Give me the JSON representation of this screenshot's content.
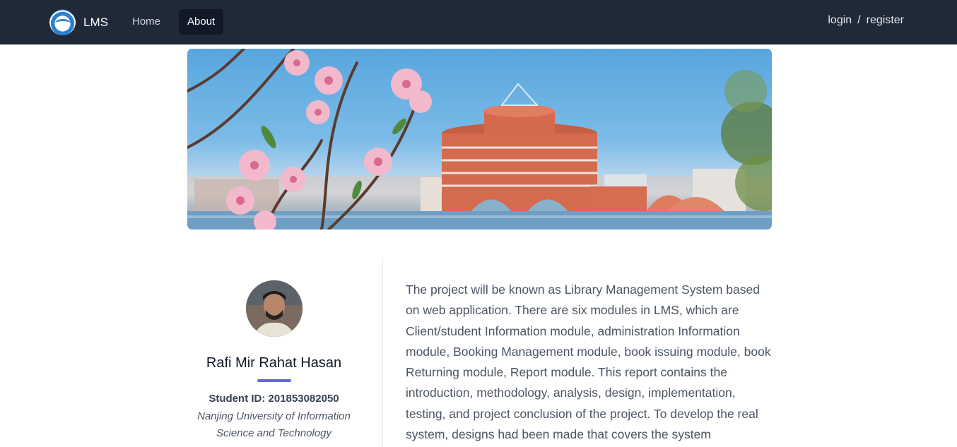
{
  "nav": {
    "brand": "LMS",
    "links": [
      "Home",
      "About"
    ],
    "active": "About",
    "login": "login",
    "separator": "/",
    "register": "register"
  },
  "hero": {
    "alt": "Campus building with blossoms"
  },
  "profile": {
    "name": "Rafi Mir Rahat Hasan",
    "student_id": "Student ID: 201853082050",
    "university": "Nanjing University of Information Science and Technology"
  },
  "about": {
    "text": "The project will be known as Library Management System based on web application. There are six modules in LMS, which are Client/student Information module, administration Information module, Booking Management module, book issuing module, book Returning module, Report module. This report contains the introduction, methodology, analysis, design, implementation, testing, and project conclusion of the project. To develop the real system, designs had been made that covers the system"
  },
  "colors": {
    "navbar": "#1f2937",
    "active_tab": "#111827",
    "accent": "#6366f1"
  }
}
